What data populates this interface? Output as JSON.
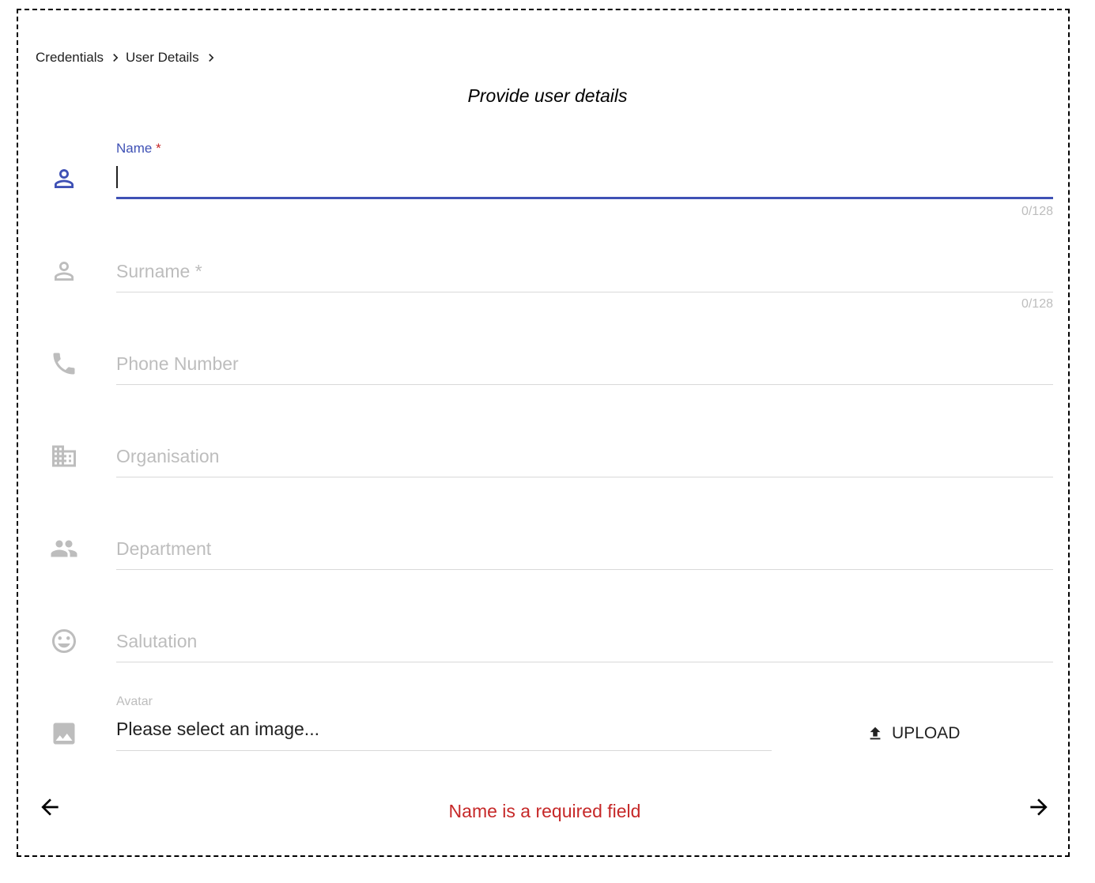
{
  "breadcrumb": {
    "items": [
      "Credentials",
      "User Details"
    ]
  },
  "page_title": "Provide user details",
  "form": {
    "name": {
      "label": "Name",
      "required_mark": "*",
      "value": "",
      "counter": "0/128",
      "icon": "person-outline-icon"
    },
    "surname": {
      "placeholder": "Surname *",
      "value": "",
      "counter": "0/128",
      "icon": "person-outline-icon"
    },
    "phone": {
      "placeholder": "Phone Number",
      "value": "",
      "icon": "phone-icon"
    },
    "organisation": {
      "placeholder": "Organisation",
      "value": "",
      "icon": "business-icon"
    },
    "department": {
      "placeholder": "Department",
      "value": "",
      "icon": "people-icon"
    },
    "salutation": {
      "placeholder": "Salutation",
      "value": "",
      "icon": "smiley-icon"
    },
    "avatar": {
      "label": "Avatar",
      "value": "Please select an image...",
      "icon": "image-icon"
    }
  },
  "upload_label": "UPLOAD",
  "error_message": "Name is a required field",
  "colors": {
    "accent": "#3f51b5",
    "error": "#c62828",
    "muted": "#bdbdbd"
  }
}
